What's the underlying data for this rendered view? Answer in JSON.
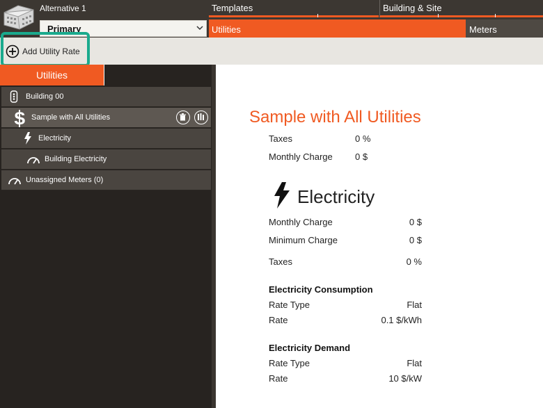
{
  "header": {
    "alternative_label": "Alternative 1",
    "alternative_selected": "Primary",
    "tabs": [
      {
        "label": "Templates"
      },
      {
        "label": "Building & Site"
      }
    ],
    "subtabs": [
      {
        "label": "Utilities",
        "active": true
      },
      {
        "label": "Meters",
        "active": false
      }
    ]
  },
  "toolbar": {
    "add_label": "Add Utility Rate"
  },
  "sidebar": {
    "tab_label": "Utilities",
    "tree": [
      {
        "label": "Building 00",
        "icon": "building-icon"
      },
      {
        "label": "Sample with All Utilities",
        "icon": "dollar-icon",
        "selected": true
      },
      {
        "label": "Electricity",
        "icon": "lightning-icon"
      },
      {
        "label": "Building Electricity",
        "icon": "meter-gauge-icon"
      },
      {
        "label": "Unassigned Meters (0)",
        "icon": "meter-gauge-icon"
      }
    ]
  },
  "detail": {
    "title": "Sample with All Utilities",
    "taxes_label": "Taxes",
    "taxes_value": "0 %",
    "monthly_label": "Monthly Charge",
    "monthly_value": "0 $",
    "electricity": {
      "heading": "Electricity",
      "monthly_label": "Monthly Charge",
      "monthly_value": "0 $",
      "minimum_label": "Minimum Charge",
      "minimum_value": "0 $",
      "taxes_label": "Taxes",
      "taxes_value": "0 %",
      "consumption": {
        "heading": "Electricity Consumption",
        "rate_type_label": "Rate Type",
        "rate_type_value": "Flat",
        "rate_label": "Rate",
        "rate_value": "0.1 $/kWh"
      },
      "demand": {
        "heading": "Electricity Demand",
        "rate_type_label": "Rate Type",
        "rate_type_value": "Flat",
        "rate_label": "Rate",
        "rate_value": "10 $/kW"
      }
    }
  },
  "colors": {
    "accent": "#f05a22",
    "highlight": "#1aaa8d",
    "dark_bg": "#272320"
  }
}
